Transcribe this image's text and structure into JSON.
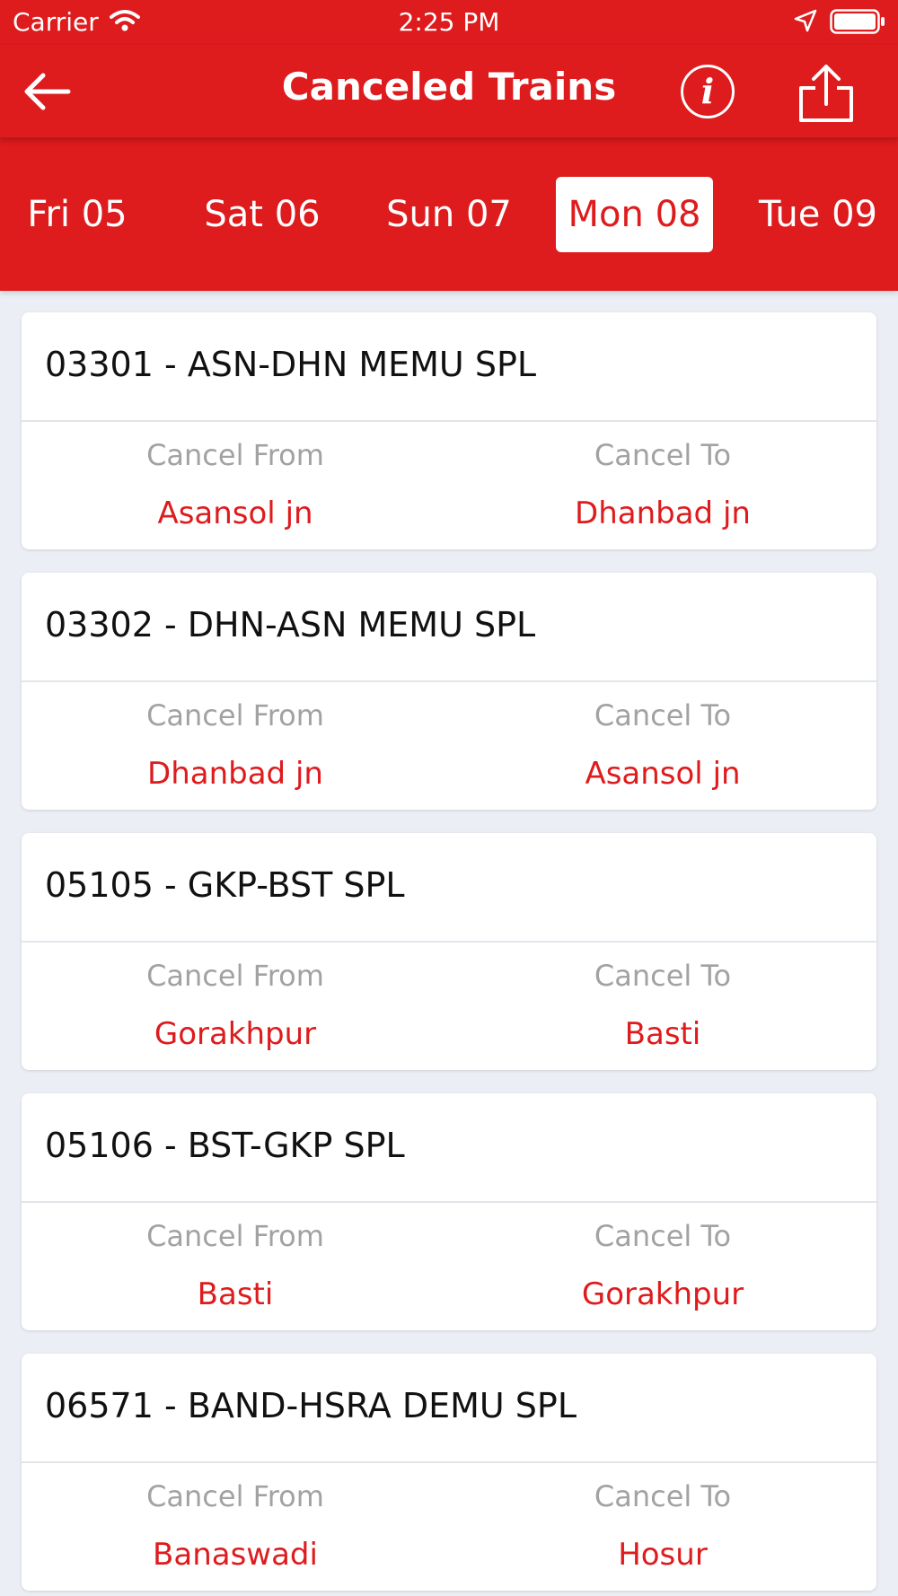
{
  "status_bar": {
    "carrier": "Carrier",
    "time": "2:25 PM"
  },
  "nav": {
    "title": "Canceled Trains",
    "info_icon_text": "i"
  },
  "dates": [
    {
      "label": "Fri 05",
      "selected": false
    },
    {
      "label": "Sat 06",
      "selected": false
    },
    {
      "label": "Sun 07",
      "selected": false
    },
    {
      "label": "Mon 08",
      "selected": true
    },
    {
      "label": "Tue 09",
      "selected": false
    }
  ],
  "labels": {
    "cancel_from": "Cancel From",
    "cancel_to": "Cancel To"
  },
  "trains": [
    {
      "title": "03301 - ASN-DHN MEMU SPL",
      "from": "Asansol jn",
      "to": "Dhanbad jn"
    },
    {
      "title": "03302 - DHN-ASN MEMU SPL",
      "from": "Dhanbad jn",
      "to": "Asansol jn"
    },
    {
      "title": "05105 - GKP-BST SPL",
      "from": "Gorakhpur",
      "to": "Basti"
    },
    {
      "title": "05106 - BST-GKP SPL",
      "from": "Basti",
      "to": "Gorakhpur"
    },
    {
      "title": "06571 - BAND-HSRA DEMU SPL",
      "from": "Banaswadi",
      "to": "Hosur"
    }
  ],
  "colors": {
    "brand_red": "#de1b1d",
    "background": "#ebeef4",
    "muted_label": "#a2a2a2"
  }
}
